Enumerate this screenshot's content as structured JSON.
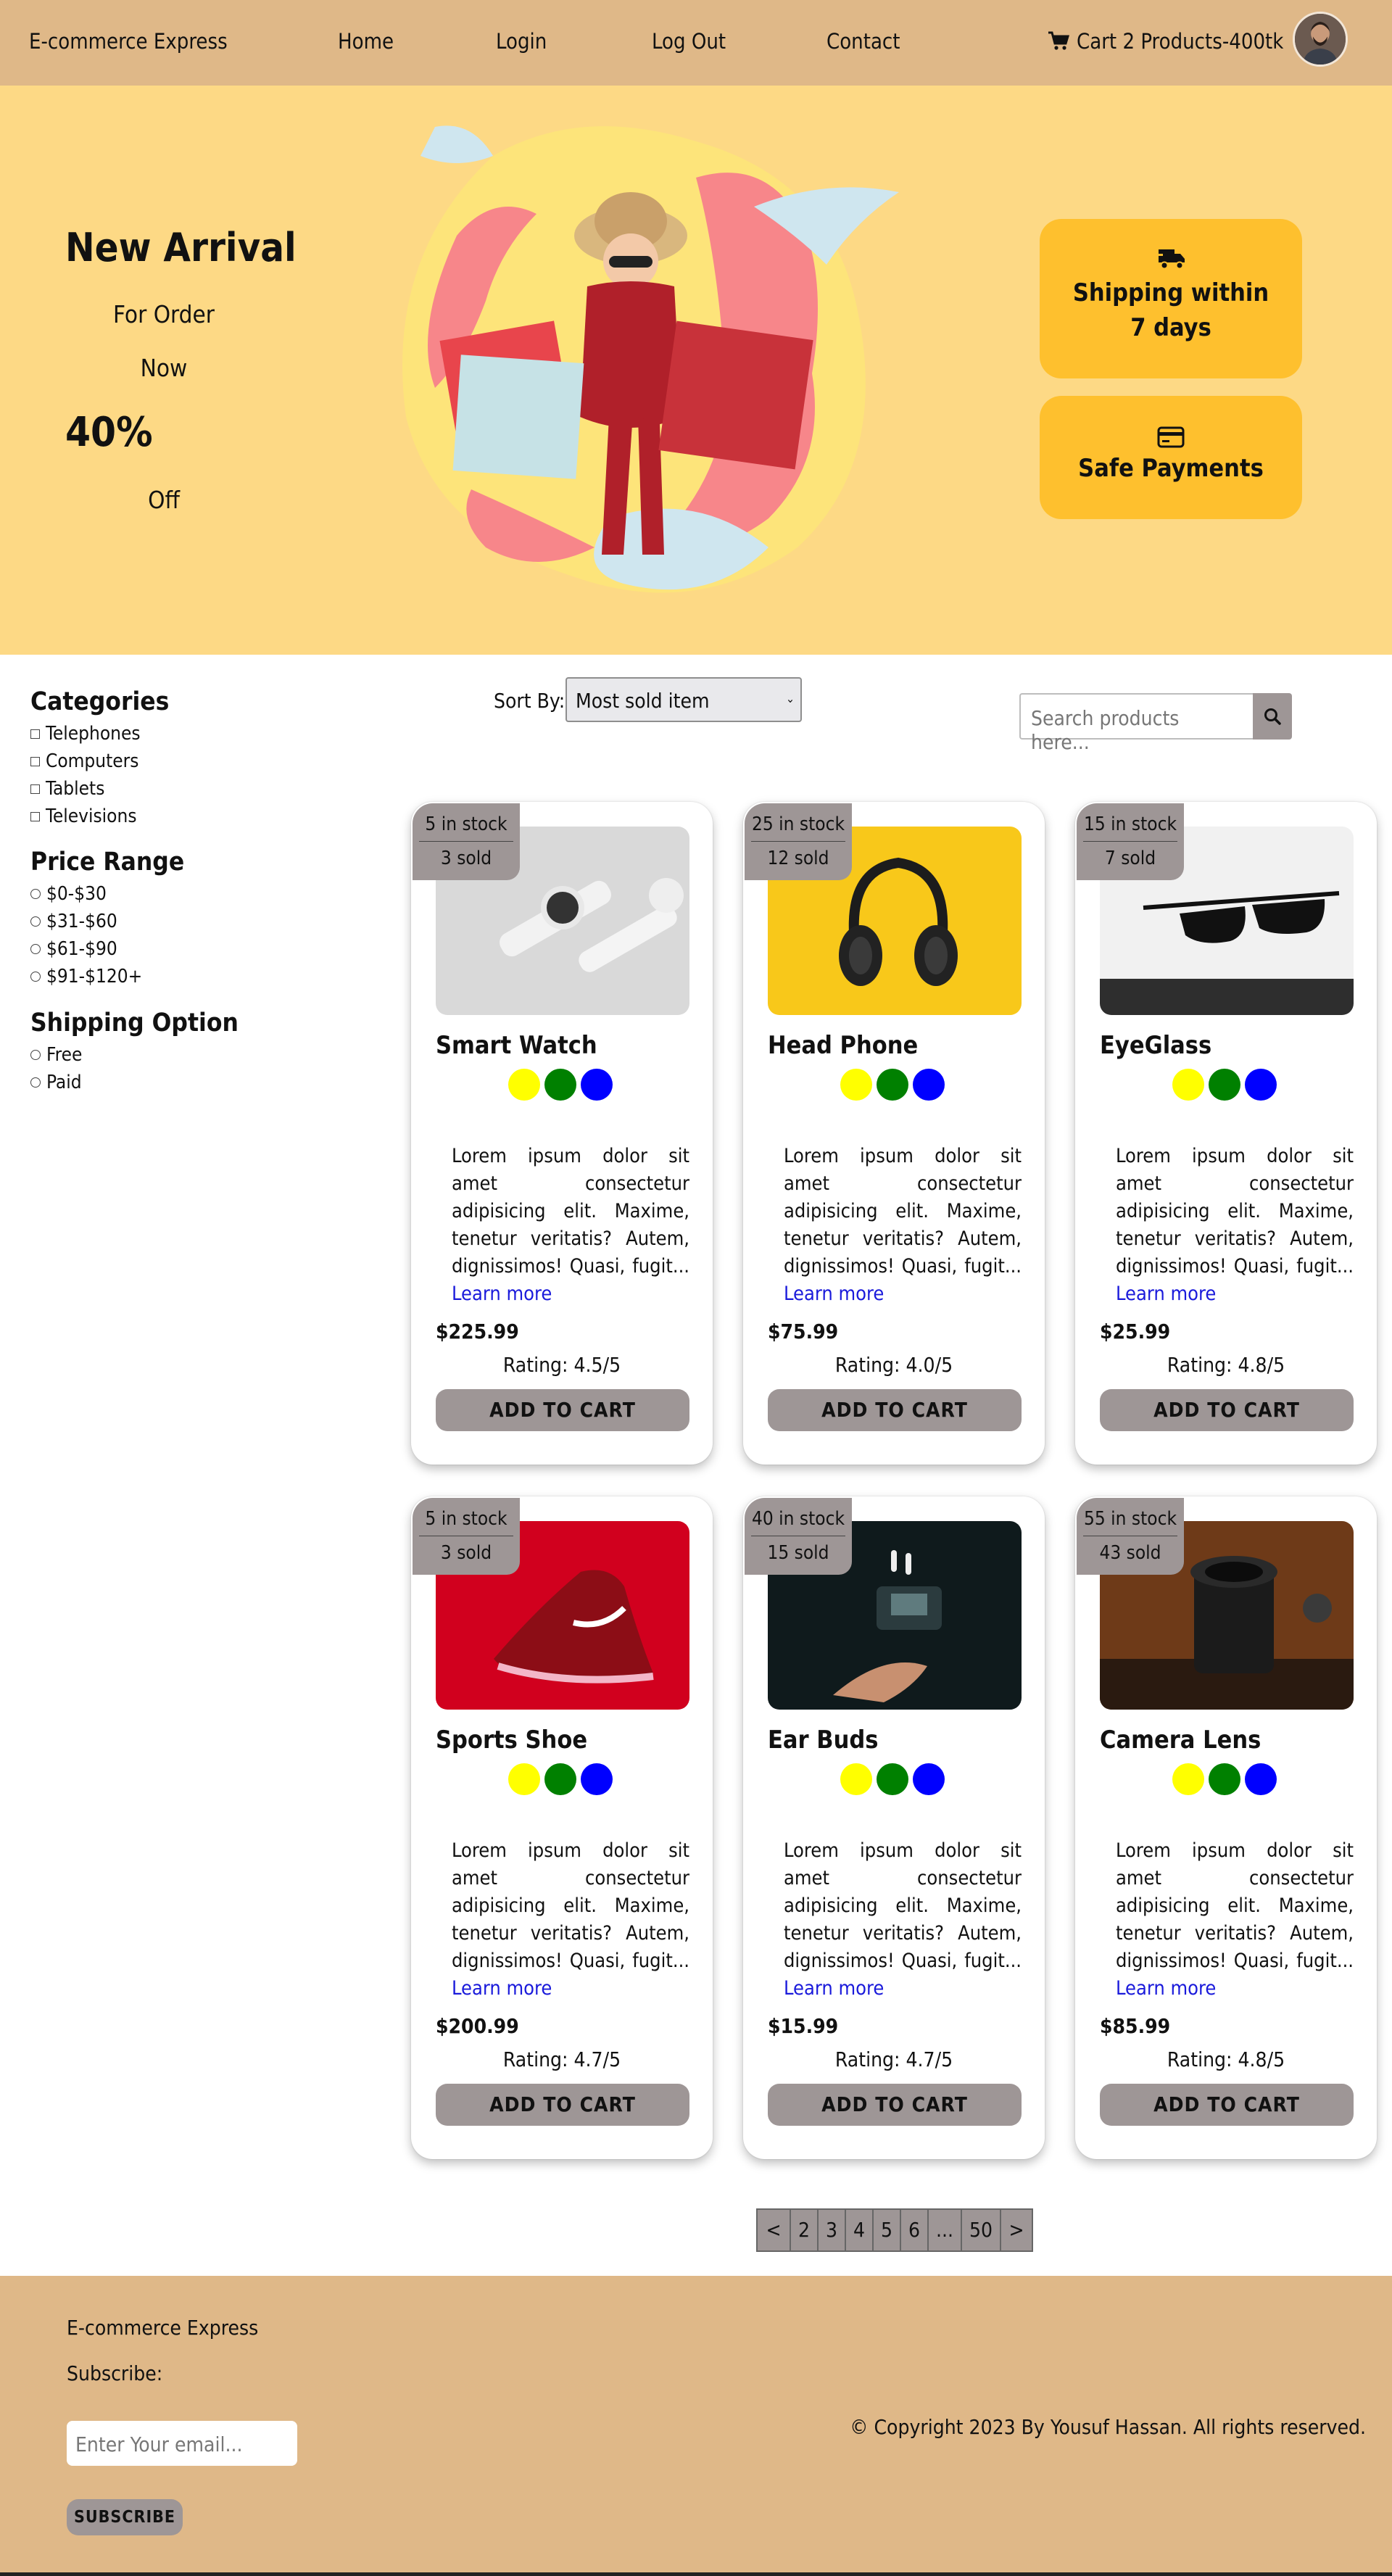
{
  "nav": {
    "brand": "E-commerce Express",
    "links": [
      "Home",
      "Login",
      "Log Out",
      "Contact"
    ],
    "cart": "Cart 2 Products-400tk"
  },
  "hero": {
    "title": "New Arrival",
    "line1": "For Order",
    "line2": "Now",
    "percent": "40%",
    "line3": "Off",
    "features": [
      "Shipping within 7 days",
      "Safe Payments"
    ]
  },
  "sidebar": {
    "categories_title": "Categories",
    "categories": [
      "Telephones",
      "Computers",
      "Tablets",
      "Televisions"
    ],
    "price_title": "Price Range",
    "prices": [
      "$0-$30",
      "$31-$60",
      "$61-$90",
      "$91-$120+"
    ],
    "shipping_title": "Shipping Option",
    "shipping": [
      "Free",
      "Paid"
    ]
  },
  "toolbar": {
    "sort_label": "Sort By:",
    "sort_value": "Most sold item",
    "search_placeholder": "Search products here..."
  },
  "products": [
    {
      "name": "Smart Watch",
      "stock": "5 in stock",
      "sold": "3 sold",
      "price": "$225.99",
      "rating": "Rating: 4.5/5"
    },
    {
      "name": "Head Phone",
      "stock": "25 in stock",
      "sold": "12 sold",
      "price": "$75.99",
      "rating": "Rating: 4.0/5"
    },
    {
      "name": "EyeGlass",
      "stock": "15 in stock",
      "sold": "7 sold",
      "price": "$25.99",
      "rating": "Rating: 4.8/5"
    },
    {
      "name": "Sports Shoe",
      "stock": "5 in stock",
      "sold": "3 sold",
      "price": "$200.99",
      "rating": "Rating: 4.7/5"
    },
    {
      "name": "Ear Buds",
      "stock": "40 in stock",
      "sold": "15 sold",
      "price": "$15.99",
      "rating": "Rating: 4.7/5"
    },
    {
      "name": "Camera Lens",
      "stock": "55 in stock",
      "sold": "43 sold",
      "price": "$85.99",
      "rating": "Rating: 4.8/5"
    }
  ],
  "card_common": {
    "description": "Lorem ipsum dolor sit amet consectetur adipisicing elit. Maxime, tenetur veritatis? Autem, dignissimos! Quasi, fugit...",
    "learn_more": "Learn more",
    "add_to_cart": "ADD TO CART",
    "swatch_colors": [
      "#ffff00",
      "#008000",
      "#0000ff"
    ]
  },
  "pagination": [
    "<",
    "2",
    "3",
    "4",
    "5",
    "6",
    "...",
    "50",
    ">"
  ],
  "footer": {
    "brand": "E-commerce Express",
    "subscribe_label": "Subscribe:",
    "email_placeholder": "Enter Your email...",
    "subscribe_button": "SUBSCRIBE",
    "copyright": "© Copyright 2023 By Yousuf Hassan. All rights reserved."
  },
  "colors": {
    "nav_bg": "#dfb888",
    "hero_bg": "#fdd985",
    "feature_bg": "#fec02e",
    "button_gray": "#9e9696",
    "link_blue": "#1a1adb"
  },
  "icons": {
    "cart": "cart-icon",
    "truck": "truck-icon",
    "card": "credit-card-icon",
    "search": "search-icon"
  }
}
